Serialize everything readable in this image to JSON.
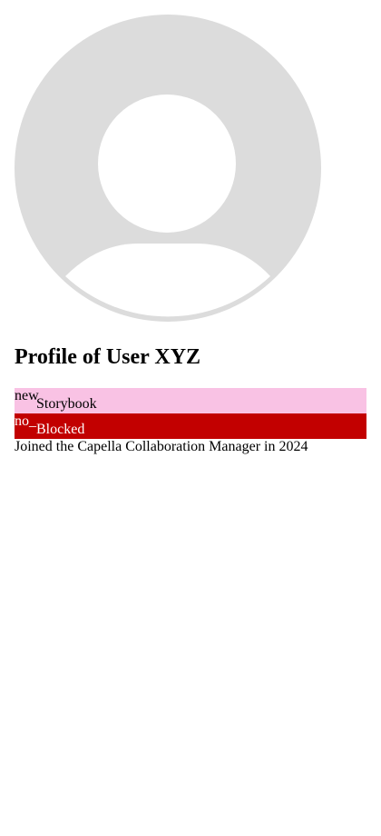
{
  "profile": {
    "avatar_icon": "person-silhouette-icon",
    "title": "Profile of User XYZ",
    "badges": [
      {
        "icon_text": "new",
        "icon": "new-icon",
        "label": "Storybook",
        "background": "#f9c2e4",
        "text_color": "#000000"
      },
      {
        "icon_text": "no_",
        "icon": "block-icon",
        "label": "Blocked",
        "background": "#c20000",
        "text_color": "#ffffff"
      }
    ],
    "joined_text": "Joined the Capella Collaboration Manager in 2024"
  },
  "colors": {
    "avatar_fill": "#dcdcdc",
    "background": "#ffffff"
  }
}
